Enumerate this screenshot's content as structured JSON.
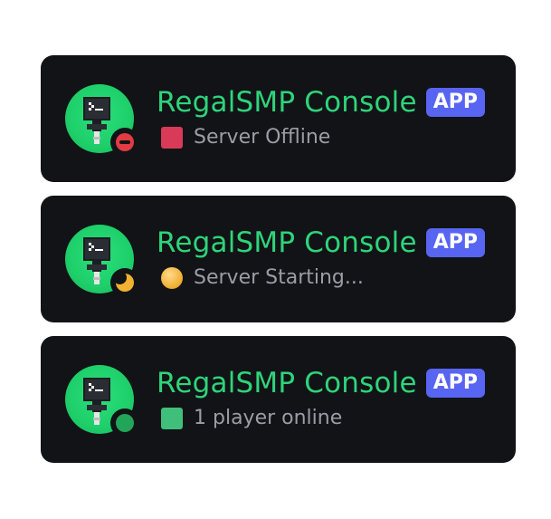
{
  "cards": [
    {
      "bot_name": "RegalSMP Console",
      "badge": "APP",
      "presence": "do-not-disturb",
      "status_emoji": "red-square-icon",
      "status_text": "Server Offline"
    },
    {
      "bot_name": "RegalSMP Console",
      "badge": "APP",
      "presence": "idle",
      "status_emoji": "yellow-circle-icon",
      "status_text": "Server Starting..."
    },
    {
      "bot_name": "RegalSMP Console",
      "badge": "APP",
      "presence": "online",
      "status_emoji": "green-square-icon",
      "status_text": "1 player online"
    }
  ],
  "colors": {
    "card_bg": "#121316",
    "name": "#2ed47a",
    "badge_bg": "#5865f2",
    "status_text": "#9a9da4",
    "avatar_green": "#1ecf6a",
    "dnd": "#e23b43",
    "idle": "#f0b232",
    "online": "#23a559"
  }
}
